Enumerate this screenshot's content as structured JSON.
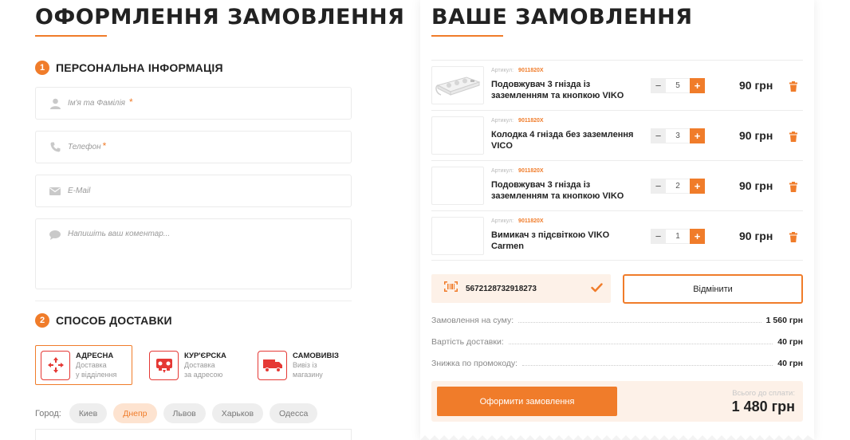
{
  "left": {
    "title": "ОФОРМЛЕННЯ ЗАМОВЛЕННЯ",
    "personal": {
      "number": "1",
      "title": "ПЕРСОНАЛЬНА ІНФОРМАЦІЯ",
      "name_placeholder": "Ім'я та Фамілія",
      "phone_placeholder": "Телефон",
      "email_placeholder": "E-Mail",
      "comment_placeholder": "Напишіть ваш коментар...",
      "required_mark": "*"
    },
    "delivery": {
      "number": "2",
      "title": "СПОСОБ ДОСТАВКИ",
      "options": [
        {
          "title": "АДРЕСНА",
          "line1": "Доставка",
          "line2": "у відділення",
          "icon": "nova-poshta-icon",
          "selected": true
        },
        {
          "title": "КУР'ЄРСКА",
          "line1": "Доставка",
          "line2": "за адресою",
          "icon": "courier-icon",
          "selected": false
        },
        {
          "title": "САМОВИВІЗ",
          "line1": "Вивіз із",
          "line2": "магазину",
          "icon": "truck-icon",
          "selected": false
        }
      ]
    },
    "city": {
      "label": "Город:",
      "options": [
        "Киев",
        "Днепр",
        "Львов",
        "Харьков",
        "Одесса"
      ],
      "selected": "Днепр"
    }
  },
  "right": {
    "title": "ВАШЕ ЗАМОВЛЕННЯ",
    "sku_label": "Артикул:",
    "items": [
      {
        "sku": "9011820X",
        "name": "Подовжувач 3 гнізда із заземленням та кнопкою VIKO",
        "qty": "5",
        "price": "90 грн"
      },
      {
        "sku": "9011820X",
        "name": "Колодка 4 гнізда без заземлення VICO",
        "qty": "3",
        "price": "90 грн"
      },
      {
        "sku": "9011820X",
        "name": "Подовжувач 3 гнізда із заземленням та кнопкою VIKO",
        "qty": "2",
        "price": "90 грн"
      },
      {
        "sku": "9011820X",
        "name": "Вимикач з підсвіткою VIKO Carmen",
        "qty": "1",
        "price": "90 грн"
      }
    ],
    "qty_minus": "−",
    "qty_plus": "+",
    "promo": {
      "code": "5672128732918273"
    },
    "cancel_label": "Відмінити",
    "summary": [
      {
        "label": "Замовлення на суму:",
        "value": "1 560 грн"
      },
      {
        "label": "Вартість доставки:",
        "value": "40 грн"
      },
      {
        "label": "Знижка по промокоду:",
        "value": "40 грн"
      }
    ],
    "order_button": "Оформити замовлення",
    "total_label": "Всього до сплати:",
    "total_value": "1 480 грн"
  },
  "colors": {
    "accent": "#f07c2a",
    "delivery_red": "#e53935",
    "promo_bg": "#fdf1e8"
  }
}
